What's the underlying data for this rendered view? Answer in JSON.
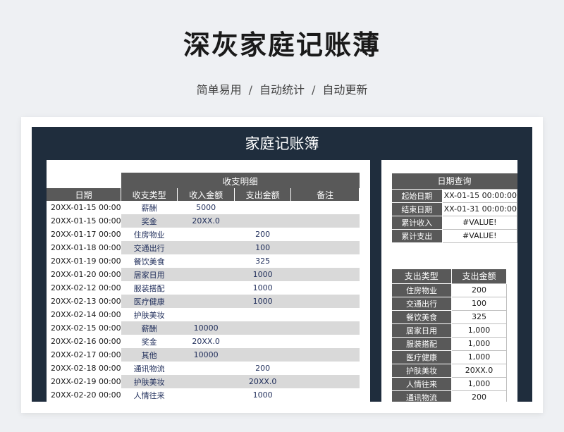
{
  "header": {
    "title": "深灰家庭记账薄",
    "subtitle_parts": [
      "简单易用",
      "自动统计",
      "自动更新"
    ],
    "separator": "/"
  },
  "sheet": {
    "title": "家庭记账簿"
  },
  "ledger": {
    "section_title": "收支明细",
    "columns": [
      "日期",
      "收支类型",
      "收入金额",
      "支出金额",
      "备注"
    ],
    "rows": [
      {
        "date": "20XX-01-15 00:00",
        "type": "薪酬",
        "income": "5000",
        "expense": "",
        "note": ""
      },
      {
        "date": "20XX-01-15 00:00",
        "type": "奖金",
        "income": "20XX.0",
        "expense": "",
        "note": ""
      },
      {
        "date": "20XX-01-17 00:00",
        "type": "住房物业",
        "income": "",
        "expense": "200",
        "note": ""
      },
      {
        "date": "20XX-01-18 00:00",
        "type": "交通出行",
        "income": "",
        "expense": "100",
        "note": ""
      },
      {
        "date": "20XX-01-19 00:00",
        "type": "餐饮美食",
        "income": "",
        "expense": "325",
        "note": ""
      },
      {
        "date": "20XX-01-20 00:00",
        "type": "居家日用",
        "income": "",
        "expense": "1000",
        "note": ""
      },
      {
        "date": "20XX-02-12 00:00",
        "type": "服装搭配",
        "income": "",
        "expense": "1000",
        "note": ""
      },
      {
        "date": "20XX-02-13 00:00",
        "type": "医疗健康",
        "income": "",
        "expense": "1000",
        "note": ""
      },
      {
        "date": "20XX-02-14 00:00",
        "type": "护肤美妆",
        "income": "",
        "expense": "",
        "note": ""
      },
      {
        "date": "20XX-02-15 00:00",
        "type": "薪酬",
        "income": "10000",
        "expense": "",
        "note": ""
      },
      {
        "date": "20XX-02-16 00:00",
        "type": "奖金",
        "income": "20XX.0",
        "expense": "",
        "note": ""
      },
      {
        "date": "20XX-02-17 00:00",
        "type": "其他",
        "income": "10000",
        "expense": "",
        "note": ""
      },
      {
        "date": "20XX-02-18 00:00",
        "type": "通讯物流",
        "income": "",
        "expense": "200",
        "note": ""
      },
      {
        "date": "20XX-02-19 00:00",
        "type": "护肤美妆",
        "income": "",
        "expense": "20XX.0",
        "note": ""
      },
      {
        "date": "20XX-02-20 00:00",
        "type": "人情往来",
        "income": "",
        "expense": "1000",
        "note": ""
      }
    ]
  },
  "date_query": {
    "title": "日期查询",
    "rows": [
      {
        "label": "起始日期",
        "value": "XX-01-15 00:00:00"
      },
      {
        "label": "结束日期",
        "value": "XX-01-31 00:00:00"
      },
      {
        "label": "累计收入",
        "value": "#VALUE!"
      },
      {
        "label": "累计支出",
        "value": "#VALUE!"
      }
    ]
  },
  "expense_summary": {
    "columns": [
      "支出类型",
      "支出金额"
    ],
    "rows": [
      {
        "type": "住房物业",
        "amount": "200"
      },
      {
        "type": "交通出行",
        "amount": "100"
      },
      {
        "type": "餐饮美食",
        "amount": "325"
      },
      {
        "type": "居家日用",
        "amount": "1,000"
      },
      {
        "type": "服装搭配",
        "amount": "1,000"
      },
      {
        "type": "医疗健康",
        "amount": "1,000"
      },
      {
        "type": "护肤美妆",
        "amount": "20XX.0"
      },
      {
        "type": "人情往来",
        "amount": "1,000"
      },
      {
        "type": "通讯物流",
        "amount": "200"
      }
    ]
  }
}
